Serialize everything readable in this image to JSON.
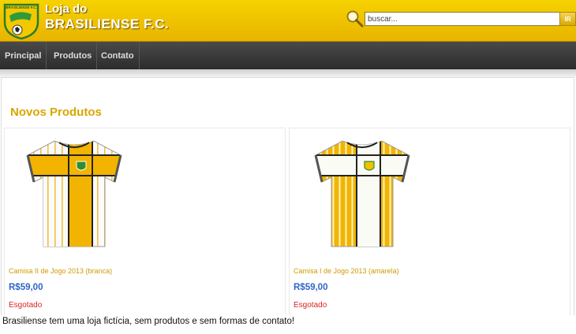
{
  "header": {
    "title_line1": "Loja do",
    "title_line2": "BRASILIENSE F.C.",
    "logo_text": "BRASILIENSE F.C."
  },
  "search": {
    "placeholder": "buscar...",
    "button_label": "IR"
  },
  "nav": {
    "items": [
      "Principal",
      "Produtos",
      "Contato"
    ]
  },
  "main": {
    "section_title": "Novos Produtos",
    "products": [
      {
        "name": "Camisa II de Jogo 2013 (branca)",
        "price": "R$59,00",
        "status": "Esgotado"
      },
      {
        "name": "Camisa I de Jogo 2013 (amarela)",
        "price": "R$59,00",
        "status": "Esgotado"
      }
    ]
  },
  "caption": "Brasiliense tem uma loja fictícia, sem produtos e sem formas de contato!",
  "colors": {
    "brand_yellow": "#f2c500",
    "nav_dark": "#333333",
    "title_gold": "#d9a600",
    "price_blue": "#2e66c8",
    "status_red": "#dd2222"
  }
}
